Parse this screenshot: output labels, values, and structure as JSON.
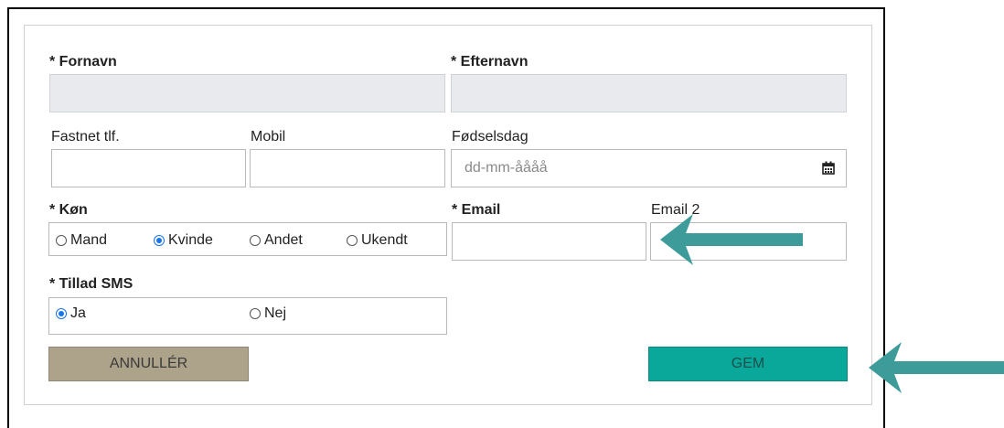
{
  "form": {
    "first_name": {
      "label": "* Fornavn",
      "value": ""
    },
    "last_name": {
      "label": "* Efternavn",
      "value": ""
    },
    "landline": {
      "label": "Fastnet tlf.",
      "value": ""
    },
    "mobile": {
      "label": "Mobil",
      "value": ""
    },
    "birthday": {
      "label": "Fødselsdag",
      "placeholder": "dd-mm-åååå"
    },
    "gender": {
      "label": "* Køn",
      "options": [
        "Mand",
        "Kvinde",
        "Andet",
        "Ukendt"
      ],
      "selected": "Kvinde"
    },
    "email": {
      "label": "* Email",
      "value": ""
    },
    "email2": {
      "label": "Email 2",
      "value": ""
    },
    "sms": {
      "label": "* Tillad SMS",
      "options": [
        "Ja",
        "Nej"
      ],
      "selected": "Ja"
    }
  },
  "buttons": {
    "cancel_label": "ANNULLÉR",
    "save_label": "GEM"
  },
  "colors": {
    "cancel_bg": "#ada28a",
    "save_bg": "#0aa89a",
    "arrow": "#3d9c9a",
    "radio_selected": "#1a73e8",
    "readonly_field": "#e8eaed"
  },
  "icons": {
    "birthday_picker": "calendar-icon",
    "annotation": "left-arrow-icon"
  }
}
